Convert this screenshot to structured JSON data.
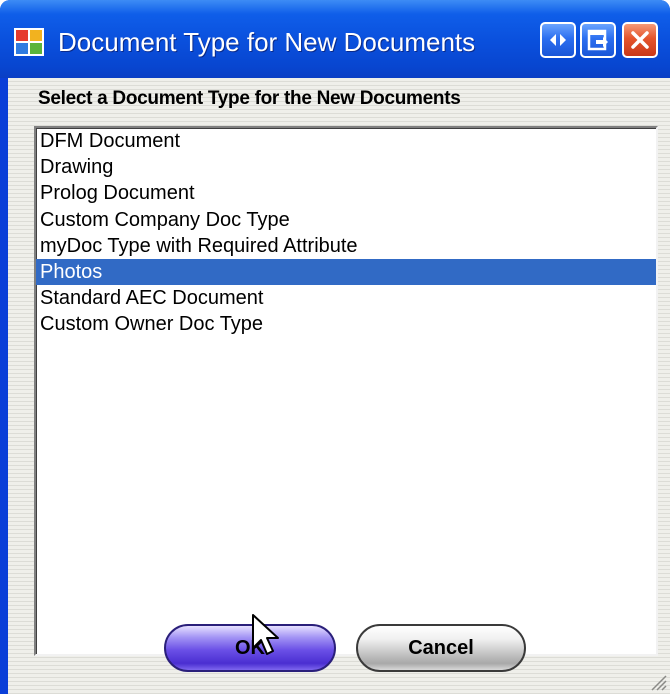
{
  "window": {
    "title": "Document Type for New Documents"
  },
  "title_buttons": {
    "restore_icon": "left-right-arrows-icon",
    "minimize_icon": "exit-window-icon",
    "close_icon": "close-icon"
  },
  "prompt": "Select a Document Type for the New Documents",
  "list": {
    "items": [
      "DFM Document",
      "Drawing",
      "Prolog Document",
      "Custom Company Doc Type",
      "myDoc Type with Required Attribute",
      "Photos",
      "Standard AEC Document",
      "Custom Owner Doc Type"
    ],
    "selected": "Photos",
    "selected_color": "#316ac5"
  },
  "buttons": {
    "ok_label": "OK",
    "cancel_label": "Cancel"
  },
  "colors": {
    "titlebar": "#0a4fdc",
    "close": "#e5542b",
    "ok_button": "#6a4fe6"
  }
}
